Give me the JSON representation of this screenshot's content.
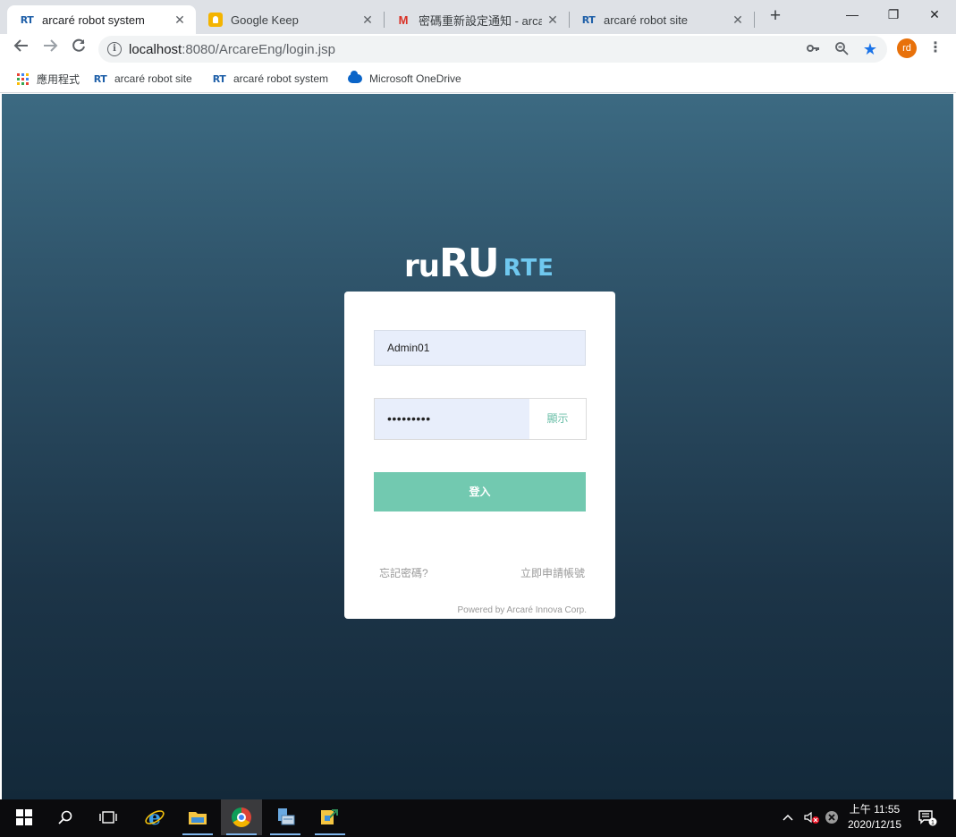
{
  "browser": {
    "tabs": [
      {
        "title": "arcaré robot system",
        "favicon": "rt-icon",
        "active": true
      },
      {
        "title": "Google Keep",
        "favicon": "google-keep-icon",
        "active": false
      },
      {
        "title": "密碼重新設定通知 - arcare",
        "favicon": "gmail-icon",
        "active": false
      },
      {
        "title": "arcaré robot site",
        "favicon": "rt-icon",
        "active": false
      }
    ],
    "favicon_text": "RT",
    "new_tab": "+",
    "window_controls": {
      "minimize": "—",
      "restore": "❐",
      "close": "✕"
    },
    "address": {
      "host": "localhost",
      "path": ":8080/ArcareEng/login.jsp"
    },
    "profile_initials": "rd",
    "bookmarks": [
      {
        "label": "應用程式",
        "icon": "apps-grid-icon"
      },
      {
        "label": "arcaré robot site",
        "icon": "rt-icon"
      },
      {
        "label": "arcaré robot system",
        "icon": "rt-icon"
      },
      {
        "label": "Microsoft OneDrive",
        "icon": "onedrive-cloud-icon"
      }
    ]
  },
  "login": {
    "logo_ru_small": "ru",
    "logo_ru_big": "RU",
    "logo_rte": "RTE",
    "username_value": "Admin01",
    "password_masked": "•••••••••",
    "show_password_label": "顯示",
    "login_button_label": "登入",
    "forgot_password_label": "忘記密碼?",
    "register_label": "立即申請帳號",
    "powered_by": "Powered by Arcaré Innova Corp."
  },
  "taskbar": {
    "clock_time": "上午 11:55",
    "clock_date": "2020/12/15",
    "notification_count": "1"
  },
  "colors": {
    "accent_green": "#72c9b0",
    "logo_blue": "#6fc8ef",
    "input_fill": "#e8eefb",
    "profile_orange": "#e8710a"
  }
}
